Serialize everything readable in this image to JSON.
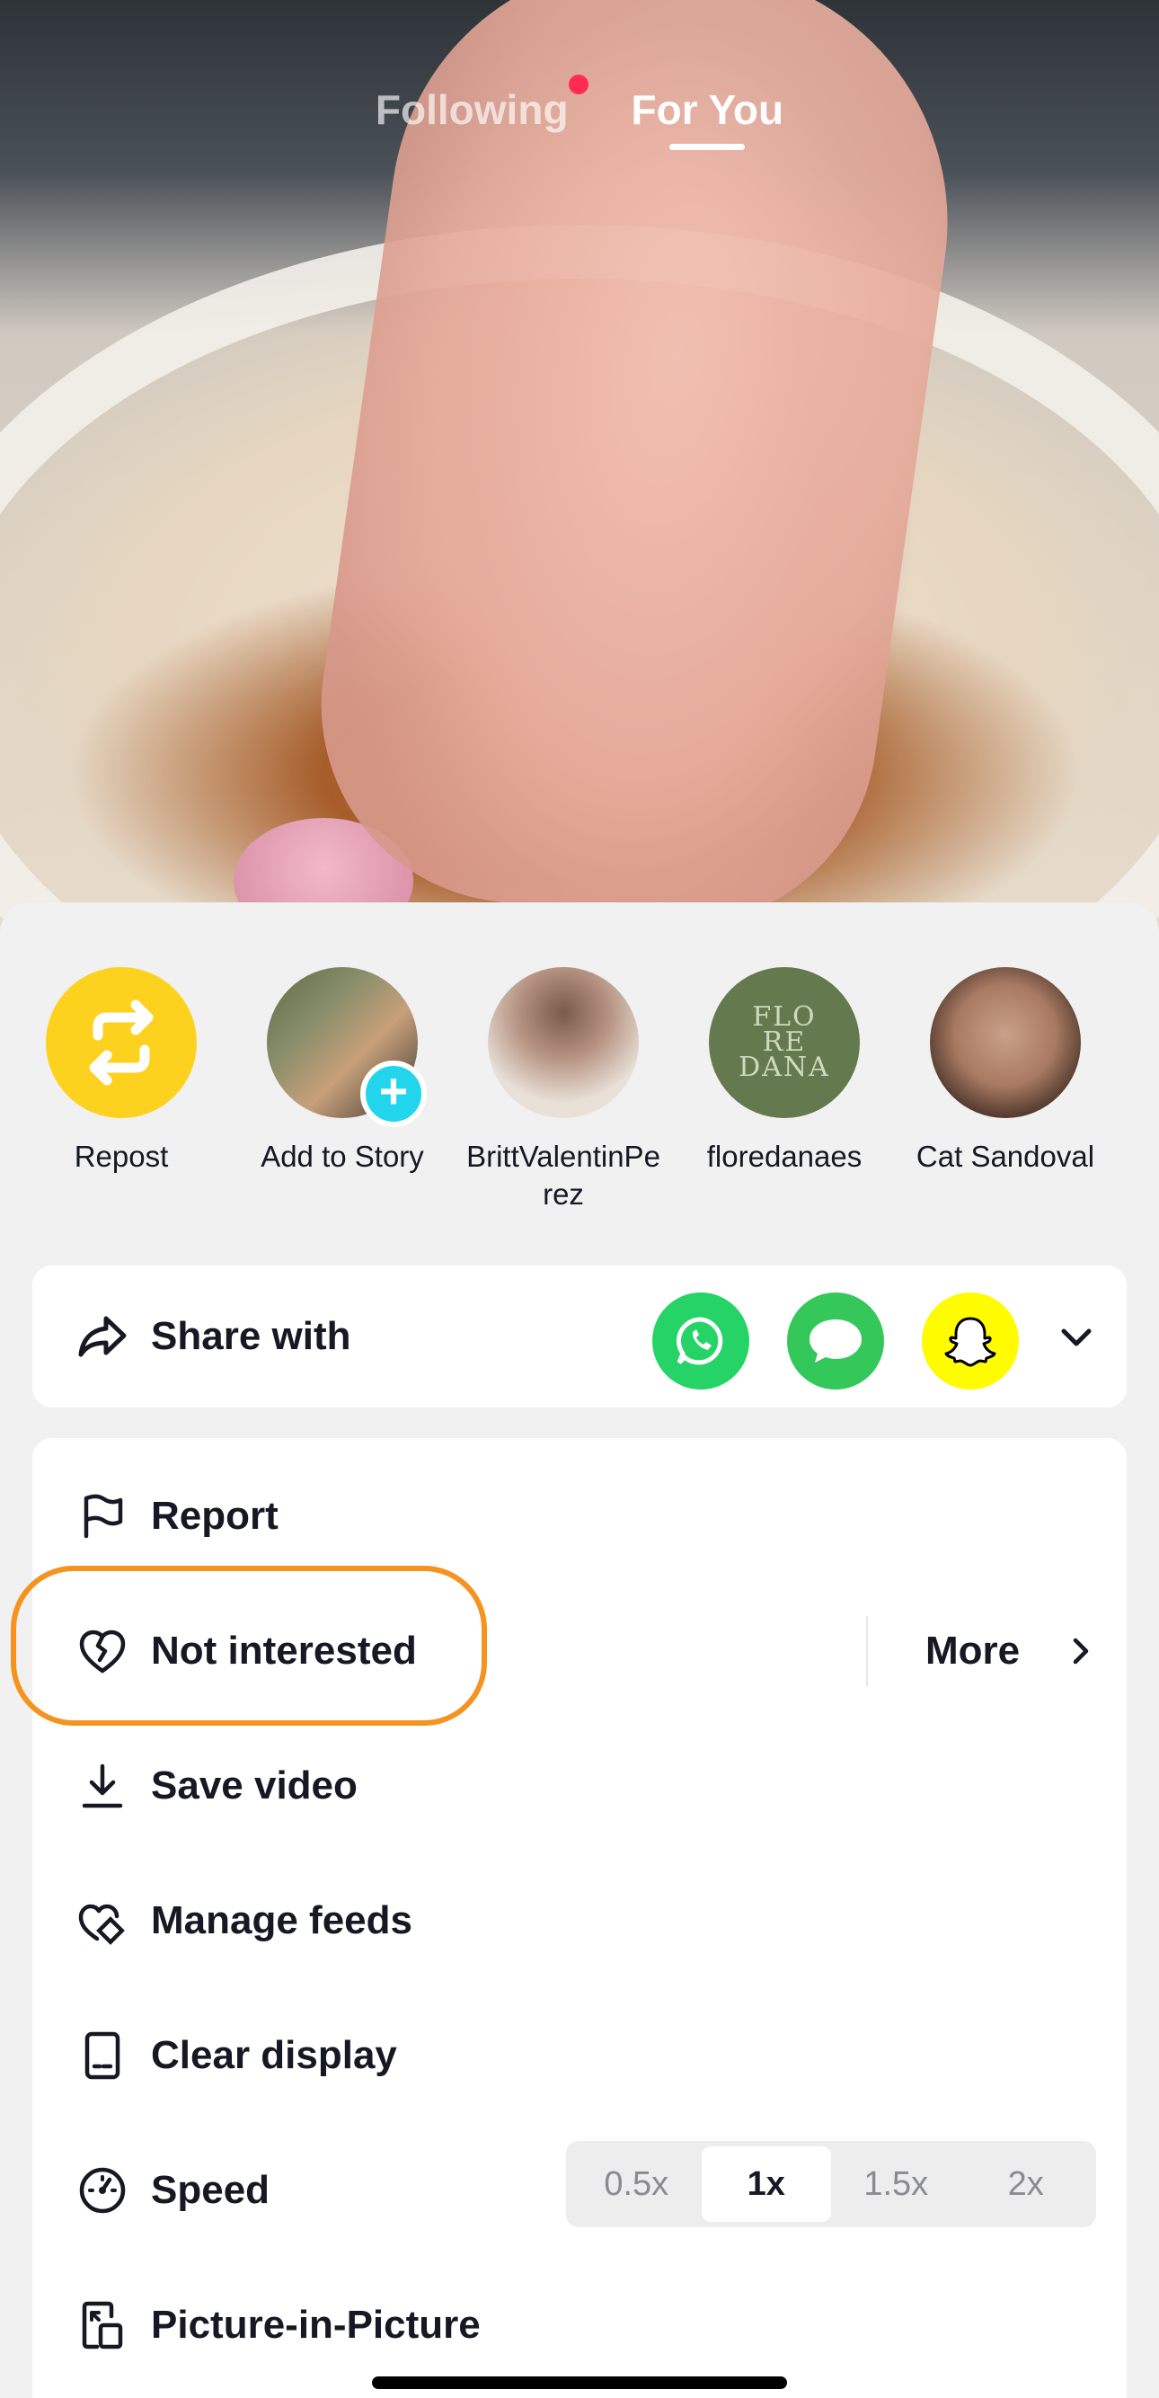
{
  "feed_tabs": {
    "following": "Following",
    "for_you": "For You"
  },
  "share_targets": [
    {
      "label": "Repost"
    },
    {
      "label": "Add to Story"
    },
    {
      "label": "BrittValentinPe\nrez"
    },
    {
      "label": "floredanaes"
    },
    {
      "label": "Cat Sandoval"
    }
  ],
  "avatar_text": {
    "floredanaes": "FLO\nRE\nDANA"
  },
  "share_with": {
    "label": "Share with",
    "apps": [
      "whatsapp-icon",
      "message-icon",
      "snapchat-icon"
    ]
  },
  "menu": {
    "report": "Report",
    "not_interested": "Not interested",
    "more": "More",
    "save_video": "Save video",
    "manage_feeds": "Manage feeds",
    "clear_display": "Clear display",
    "speed": "Speed",
    "speed_options": [
      "0.5x",
      "1x",
      "1.5x",
      "2x"
    ],
    "speed_selected": "1x",
    "pip": "Picture-in-Picture"
  },
  "colors": {
    "repost": "#fdd21f",
    "whatsapp": "#25d366",
    "messages": "#34c759",
    "snapchat": "#fffc00",
    "highlight": "#f5931e",
    "tiktok_red": "#fe2c55"
  }
}
